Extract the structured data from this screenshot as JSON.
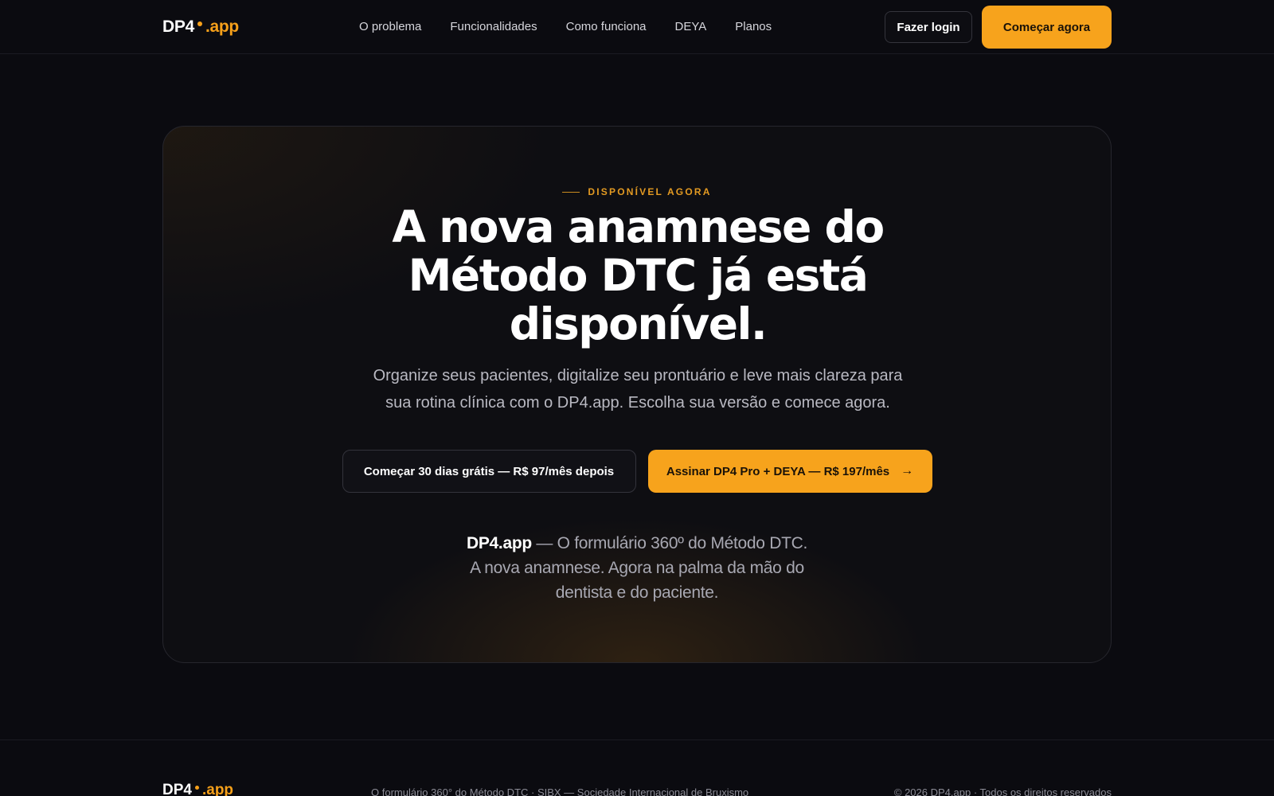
{
  "header": {
    "logo": {
      "main": "DP4",
      "ext": ".app"
    },
    "nav": [
      {
        "label": "O problema"
      },
      {
        "label": "Funcionalidades"
      },
      {
        "label": "Como funciona"
      },
      {
        "label": "DEYA"
      },
      {
        "label": "Planos"
      }
    ],
    "login_label": "Fazer login",
    "start_label": "Começar agora"
  },
  "hero": {
    "eyebrow": "DISPONÍVEL AGORA",
    "headline": "A nova anamnese do Método DTC já está disponível.",
    "subtitle": "Organize seus pacientes, digitalize seu prontuário e leve mais clareza para sua rotina clínica com o DP4.app. Escolha sua versão e comece agora.",
    "cta_trial": "Começar 30 dias grátis — R$ 97/mês depois",
    "cta_subscribe": "Assinar DP4 Pro + DEYA — R$ 197/mês",
    "cta_arrow": "→",
    "tagline_brand": "DP4.app",
    "tagline_text": " — O formulário 360º do Método DTC. A nova anamnese. Agora na palma da mão do dentista e do paciente."
  },
  "footer": {
    "logo": {
      "main": "DP4",
      "ext": ".app"
    },
    "middle": "O formulário 360° do Método DTC · SIBX — Sociedade Internacional de Bruxismo",
    "right": "© 2026 DP4.app · Todos os direitos reservados"
  },
  "colors": {
    "background": "#0b0b10",
    "accent": "#f7a31c"
  }
}
